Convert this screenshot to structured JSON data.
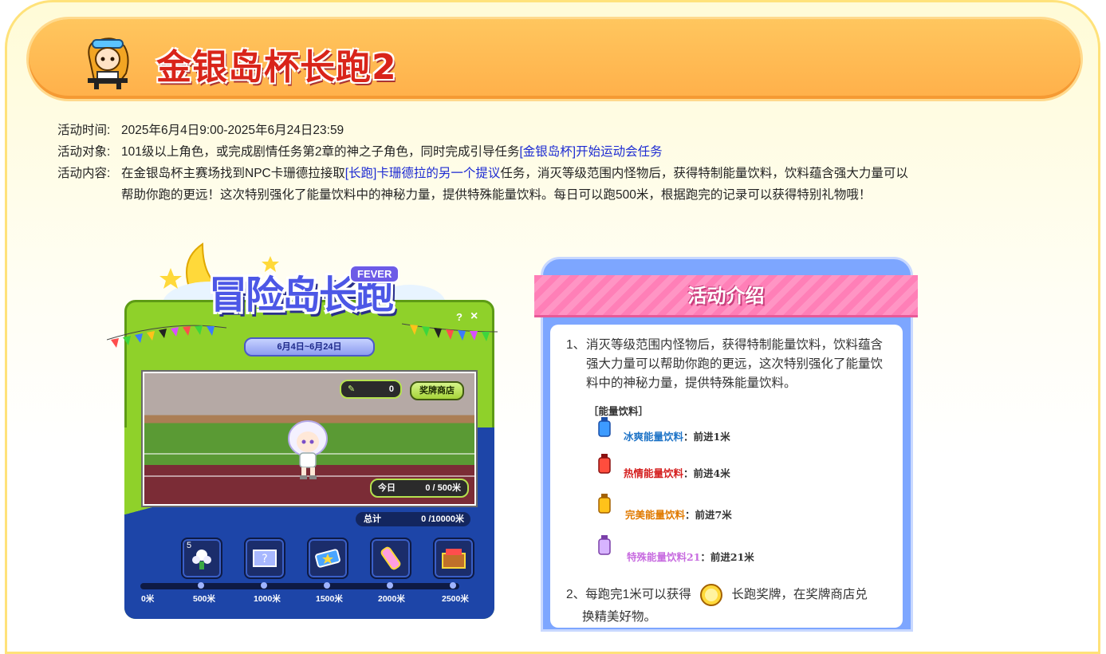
{
  "header": {
    "title": "金银岛杯长跑2"
  },
  "info": {
    "time_label": "活动时间:",
    "time_value": "2025年6月4日9:00-2025年6月24日23:59",
    "target_label": "活动对象:",
    "target_text": "101级以上角色，或完成剧情任务第2章的神之子角色，同时完成引导任务",
    "target_link": "[金银岛杯]开始运动会任务",
    "content_label": "活动内容:",
    "content_pre": "在金银岛杯主赛场找到NPC卡珊德拉接取",
    "content_link": "[长跑]卡珊德拉的另一个提议",
    "content_post": "任务，消灭等级范围内怪物后，获得特制能量饮料，饮料蕴含强大力量可以",
    "content_line2": "帮助你跑的更远！这次特别强化了能量饮料中的神秘力量，提供特殊能量饮料。每日可以跑500米，根据跑完的记录可以获得特别礼物哦！"
  },
  "game": {
    "logo": "冒险岛长跑",
    "fever": "FEVER",
    "help": "?",
    "close": "×",
    "date_range": "6月4日~6月24日",
    "medal_count": "0",
    "shop_label": "奖牌商店",
    "today_label": "今日",
    "today_value": "0 / 500米",
    "total_label": "总计",
    "total_value": "0 /10000米",
    "first_slot_count": "5",
    "ticks": [
      "0米",
      "500米",
      "1000米",
      "1500米",
      "2000米",
      "2500米"
    ]
  },
  "intro": {
    "title": "活动介绍",
    "p1_num": "1、",
    "p1_text": "消灭等级范围内怪物后，获得特制能量饮料，饮料蕴含强大力量可以帮助你跑的更远，这次特别强化了能量饮料中的神秘力量，提供特殊能量饮料。",
    "drinks_head": "［能量饮料］",
    "drinks": [
      {
        "name": "冰爽能量饮料",
        "effect": "：前进1米",
        "color": "#1f74c7"
      },
      {
        "name": "热情能量饮料",
        "effect": "：前进4米",
        "color": "#d52020"
      },
      {
        "name": "完美能量饮料",
        "effect": "：前进7米",
        "color": "#e07a00"
      },
      {
        "name": "特殊能量饮料21",
        "effect": "：前进21米",
        "color": "#c86de0"
      }
    ],
    "p2_num": "2、",
    "p2_pre": "每跑完1米可以获得",
    "p2_post": "长跑奖牌，在奖牌商店兑",
    "p2_line2": "换精美好物。"
  }
}
